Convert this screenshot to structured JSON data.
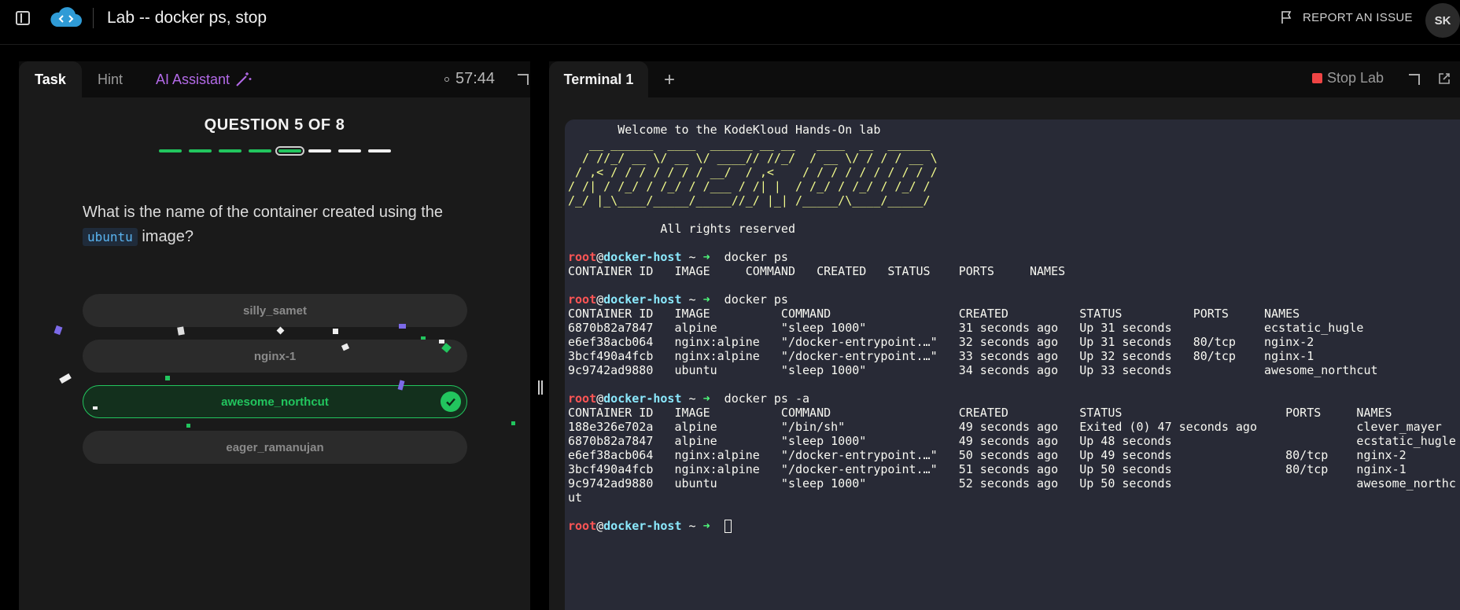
{
  "header": {
    "title": "Lab -- docker ps, stop",
    "report_label": "REPORT AN ISSUE",
    "avatar_initials": "SK"
  },
  "task_panel": {
    "tabs": [
      "Task",
      "Hint",
      "AI Assistant"
    ],
    "timer": "57:44",
    "question_heading": "QUESTION 5 OF 8",
    "progress": {
      "total": 8,
      "current": 5
    },
    "question_prefix": "What is the name of the container created using the",
    "question_code": "ubuntu",
    "question_suffix": "image?",
    "options": [
      "silly_samet",
      "nginx-1",
      "awesome_northcut",
      "eager_ramanujan"
    ],
    "selected_option": "awesome_northcut"
  },
  "terminal_panel": {
    "tab_label": "Terminal 1",
    "add_icon": "+",
    "stop_label": "Stop Lab",
    "lines": [
      {
        "t": "       Welcome to the KodeKloud Hands-On lab"
      },
      {
        "b": "   __ ______  ____  ______ __ __   ____  __  ______"
      },
      {
        "b": "  / //_/ __ \\/ __ \\/ ____// //_/  / __ \\/ / / / __ \\"
      },
      {
        "b": " / ,< / / / / / / / __/  / ,<    / / / / / / / / / /"
      },
      {
        "b": "/ /| / /_/ / /_/ / /___ / /| |  / /_/ / /_/ / /_/ /"
      },
      {
        "b": "/_/ |_\\____/_____/_____//_/ |_| /_____/\\____/_____/"
      },
      {
        "t": ""
      },
      {
        "t": "             All rights reserved"
      },
      {
        "t": ""
      },
      {
        "p": "docker ps"
      },
      {
        "t": "CONTAINER ID   IMAGE     COMMAND   CREATED   STATUS    PORTS     NAMES"
      },
      {
        "t": ""
      },
      {
        "p": "docker ps"
      },
      {
        "t": "CONTAINER ID   IMAGE          COMMAND                  CREATED          STATUS          PORTS     NAMES"
      },
      {
        "t": "6870b82a7847   alpine         \"sleep 1000\"             31 seconds ago   Up 31 seconds             ecstatic_hugle"
      },
      {
        "t": "e6ef38acb064   nginx:alpine   \"/docker-entrypoint.…\"   32 seconds ago   Up 31 seconds   80/tcp    nginx-2"
      },
      {
        "t": "3bcf490a4fcb   nginx:alpine   \"/docker-entrypoint.…\"   33 seconds ago   Up 32 seconds   80/tcp    nginx-1"
      },
      {
        "t": "9c9742ad9880   ubuntu         \"sleep 1000\"             34 seconds ago   Up 33 seconds             awesome_northcut"
      },
      {
        "t": ""
      },
      {
        "p": "docker ps -a"
      },
      {
        "t": "CONTAINER ID   IMAGE          COMMAND                  CREATED          STATUS                       PORTS     NAMES"
      },
      {
        "t": "188e326e702a   alpine         \"/bin/sh\"                49 seconds ago   Exited (0) 47 seconds ago              clever_mayer"
      },
      {
        "t": "6870b82a7847   alpine         \"sleep 1000\"             49 seconds ago   Up 48 seconds                          ecstatic_hugle"
      },
      {
        "t": "e6ef38acb064   nginx:alpine   \"/docker-entrypoint.…\"   50 seconds ago   Up 49 seconds                80/tcp    nginx-2"
      },
      {
        "t": "3bcf490a4fcb   nginx:alpine   \"/docker-entrypoint.…\"   51 seconds ago   Up 50 seconds                80/tcp    nginx-1"
      },
      {
        "t": "9c9742ad9880   ubuntu         \"sleep 1000\"             52 seconds ago   Up 50 seconds                          awesome_northc"
      },
      {
        "t": "ut"
      },
      {
        "t": ""
      },
      {
        "p": "",
        "cursor": true
      }
    ],
    "prompt": {
      "user": "root",
      "at": "@",
      "host": "docker-host",
      "dir": " ~ ",
      "arrow": "➜"
    }
  },
  "colors": {
    "accent_green": "#22c55e",
    "ai_purple": "#b36ae8",
    "stop_red": "#ef4444"
  }
}
